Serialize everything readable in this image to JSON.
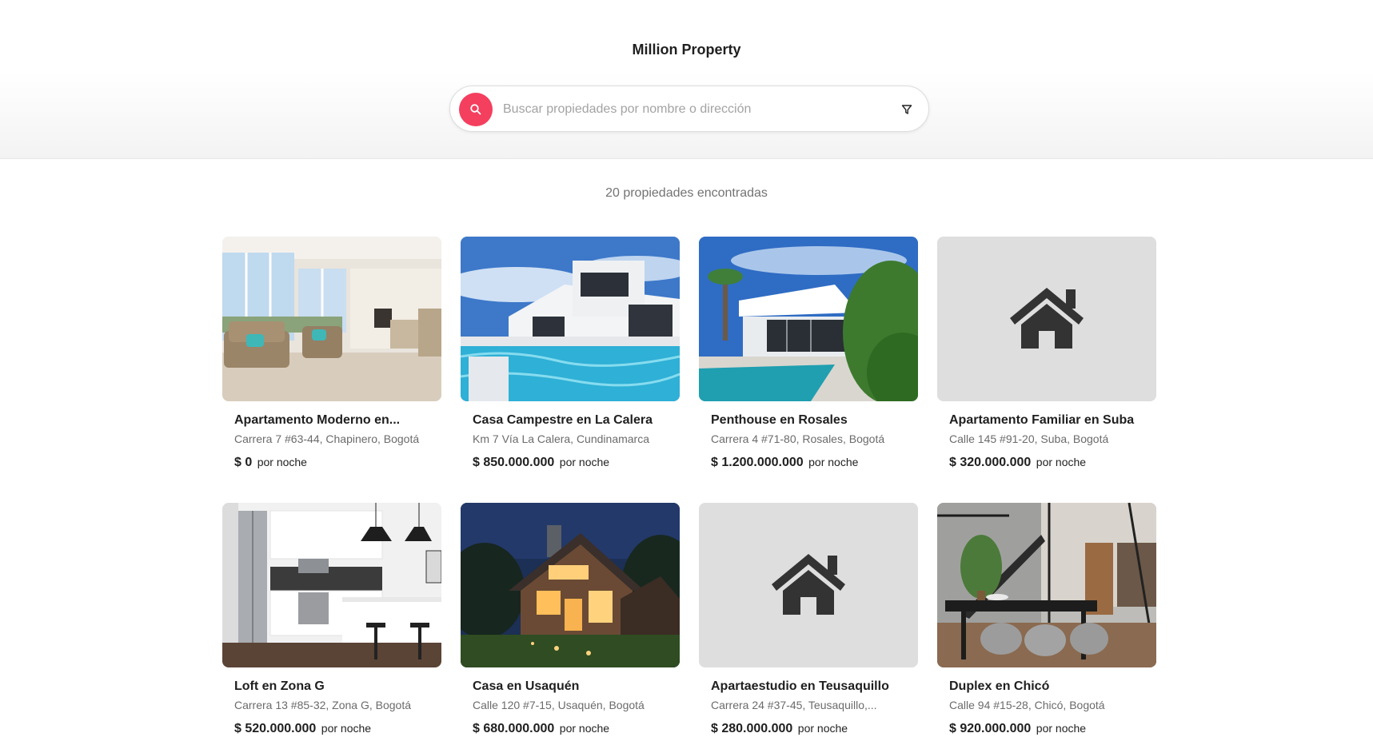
{
  "app": {
    "title": "Million Property"
  },
  "search": {
    "placeholder": "Buscar propiedades por nombre o dirección",
    "value": "",
    "search_icon": "search-icon",
    "filter_icon": "filter-icon",
    "accent_color": "#f43f5e"
  },
  "results": {
    "count_text": "20 propiedades encontradas"
  },
  "listings": [
    {
      "title": "Apartamento Moderno en...",
      "address": "Carrera 7 #63-44, Chapinero, Bogotá",
      "price": "$ 0",
      "unit": "por noche",
      "image": "living-room-photo"
    },
    {
      "title": "Casa Campestre en La Calera",
      "address": "Km 7 Vía La Calera, Cundinamarca",
      "price": "$ 850.000.000",
      "unit": "por noche",
      "image": "pool-villa-photo"
    },
    {
      "title": "Penthouse en Rosales",
      "address": "Carrera 4 #71-80, Rosales, Bogotá",
      "price": "$ 1.200.000.000",
      "unit": "por noche",
      "image": "modern-house-pool-photo"
    },
    {
      "title": "Apartamento Familiar en Suba",
      "address": "Calle 145 #91-20, Suba, Bogotá",
      "price": "$ 320.000.000",
      "unit": "por noche",
      "image": "home-icon-placeholder"
    },
    {
      "title": "Loft en Zona G",
      "address": "Carrera 13 #85-32, Zona G, Bogotá",
      "price": "$ 520.000.000",
      "unit": "por noche",
      "image": "kitchen-photo"
    },
    {
      "title": "Casa en Usaquén",
      "address": "Calle 120 #7-15, Usaquén, Bogotá",
      "price": "$ 680.000.000",
      "unit": "por noche",
      "image": "night-cabin-photo"
    },
    {
      "title": "Apartaestudio en Teusaquillo",
      "address": "Carrera 24 #37-45, Teusaquillo,...",
      "price": "$ 280.000.000",
      "unit": "por noche",
      "image": "home-icon-placeholder"
    },
    {
      "title": "Duplex en Chicó",
      "address": "Calle 94 #15-28, Chicó, Bogotá",
      "price": "$ 920.000.000",
      "unit": "por noche",
      "image": "dining-room-photo"
    }
  ]
}
